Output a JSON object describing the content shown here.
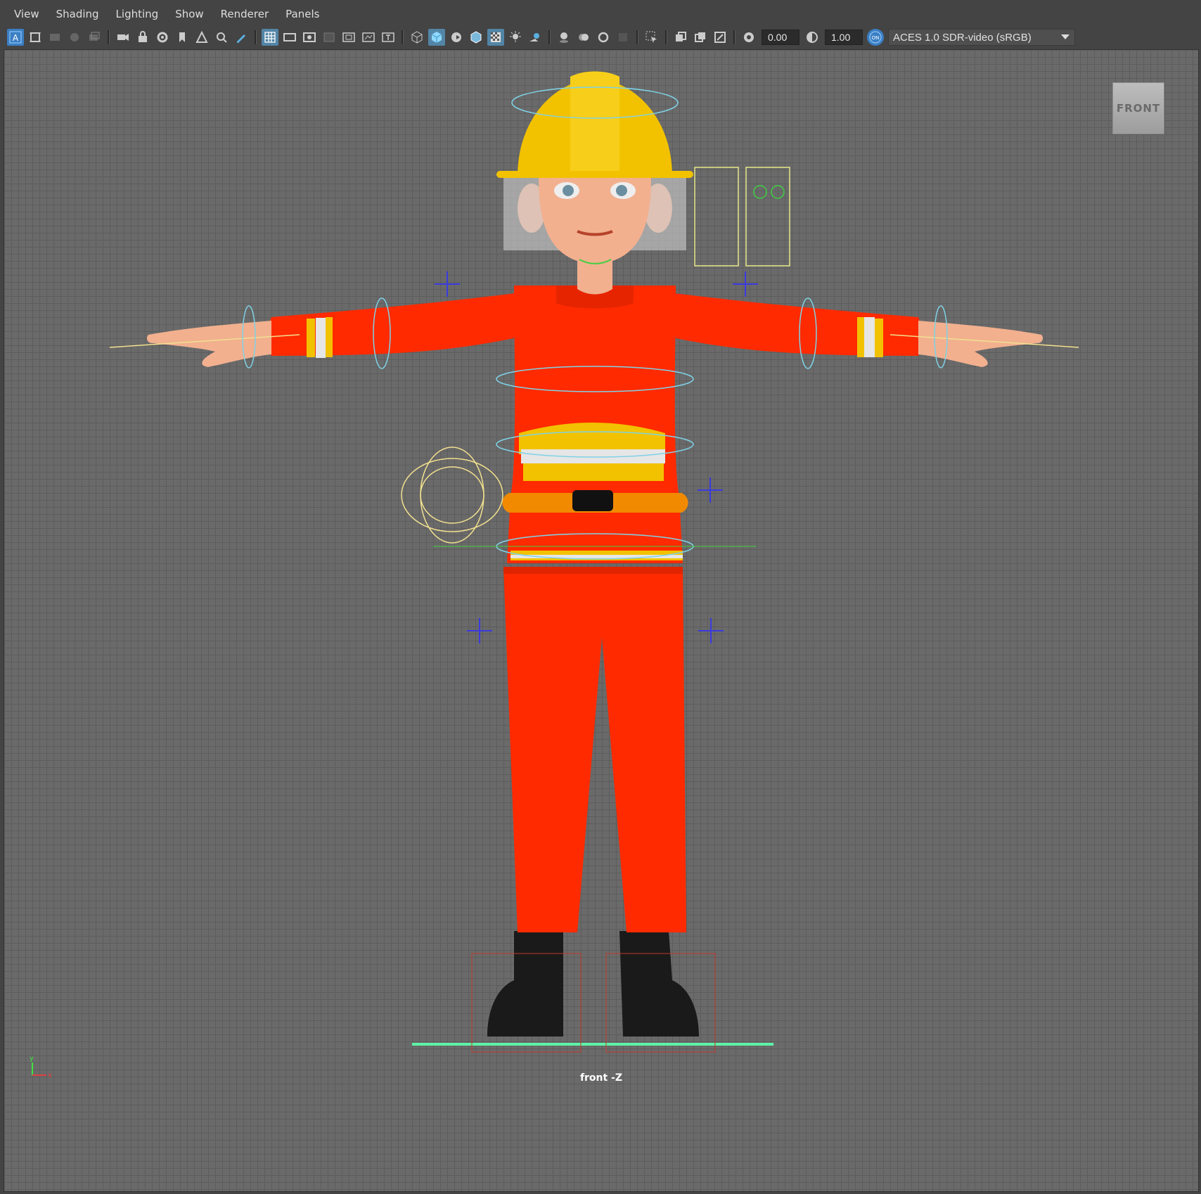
{
  "menu": {
    "items": [
      "View",
      "Shading",
      "Lighting",
      "Show",
      "Renderer",
      "Panels"
    ]
  },
  "toolbar": {
    "exposure_value": "0.00",
    "gamma_value": "1.00",
    "color_management_toggle": "ON",
    "color_management_label": "ACES 1.0 SDR-video (sRGB)"
  },
  "viewport": {
    "viewcube_label": "FRONT",
    "camera_label": "front -Z",
    "axis_y": "y",
    "axis_x": "x"
  },
  "colors": {
    "suit": "#ff2a00",
    "helmet": "#f2c200",
    "reflective_stripe": "#e6e6e6",
    "belt": "#f28a00",
    "boots": "#1a1a1a",
    "skin": "#f2b08f",
    "ground_line": "#5ef2a6",
    "active_button": "#5285a6"
  },
  "icons": [
    "select-camera-icon",
    "camera-attributes-icon",
    "bookmark-icon",
    "image-plane-icon",
    "2d-pan-zoom-icon",
    "grease-pencil-icon",
    "grid-icon",
    "film-gate-icon",
    "resolution-gate-icon",
    "gate-mask-icon",
    "field-chart-icon",
    "safe-action-icon",
    "safe-title-icon",
    "wireframe-icon",
    "smooth-shade-icon",
    "default-material-icon",
    "shade-with-wireframe-icon",
    "textured-icon",
    "lights-icon",
    "shadows-icon",
    "screen-space-ao-icon",
    "motion-blur-icon",
    "anti-aliasing-icon",
    "depth-of-field-icon",
    "isolate-select-icon",
    "xray-icon",
    "xray-joints-icon",
    "xray-components-icon",
    "exposure-icon",
    "gamma-icon",
    "color-management-icon",
    "dropdown-arrow-icon"
  ]
}
